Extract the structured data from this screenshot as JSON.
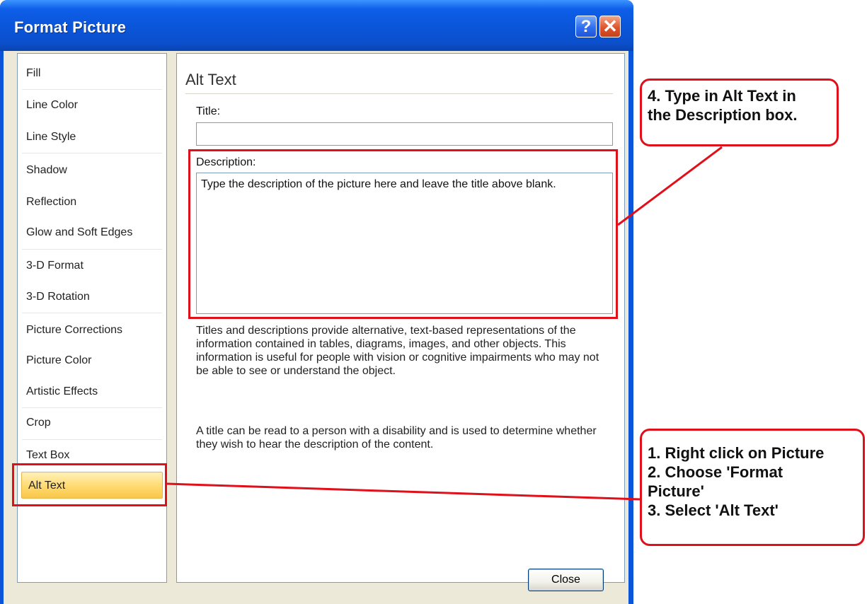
{
  "window": {
    "title": "Format Picture",
    "help_glyph": "?",
    "close_glyph": "✕"
  },
  "categories": {
    "items": [
      {
        "label": "Fill"
      },
      {
        "label": "Line Color"
      },
      {
        "label": "Line Style"
      },
      {
        "label": "Shadow"
      },
      {
        "label": "Reflection"
      },
      {
        "label": "Glow and Soft Edges"
      },
      {
        "label": "3-D Format"
      },
      {
        "label": "3-D Rotation"
      },
      {
        "label": "Picture Corrections"
      },
      {
        "label": "Picture Color"
      },
      {
        "label": "Artistic Effects"
      },
      {
        "label": "Crop"
      },
      {
        "label": "Text Box"
      },
      {
        "label": "Alt Text"
      }
    ],
    "selected": "Alt Text"
  },
  "panel": {
    "heading": "Alt Text",
    "title_label": "Title:",
    "title_value": "",
    "description_label": "Description:",
    "description_value": "Type the description of the picture here and leave the title above blank.",
    "help_para_1": "Titles and descriptions provide alternative, text-based representations of the information contained in tables, diagrams, images, and other objects. This information is useful for people with vision or cognitive impairments who may not be able to see or understand the object.",
    "help_para_2": "A title can be read to a person with a disability and is used to determine whether they wish to hear the description of the content."
  },
  "buttons": {
    "close_label": "Close"
  },
  "annotations": {
    "callout_top": [
      "4. Type in Alt Text in",
      "the Description box."
    ],
    "callout_bottom": [
      "1. Right click on Picture",
      "2. Choose 'Format",
      "Picture'",
      "3. Select 'Alt Text'"
    ],
    "highlight_color": "#e0101a"
  }
}
